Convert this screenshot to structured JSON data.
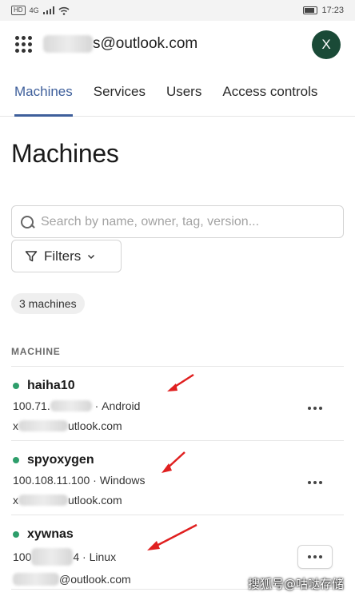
{
  "status_bar": {
    "left_chip": "HD",
    "signal": "4G",
    "time": "17:23"
  },
  "header": {
    "account_email_visible": "s@outlook.com",
    "avatar_letter": "X"
  },
  "tabs": [
    {
      "label": "Machines",
      "active": true
    },
    {
      "label": "Services",
      "active": false
    },
    {
      "label": "Users",
      "active": false
    },
    {
      "label": "Access controls",
      "active": false
    }
  ],
  "page_title": "Machines",
  "search": {
    "placeholder": "Search by name, owner, tag, version..."
  },
  "filters": {
    "label": "Filters"
  },
  "count_badge": "3 machines",
  "table": {
    "column_header": "MACHINE",
    "rows": [
      {
        "name": "haiha10",
        "ip_visible": "100.71.",
        "os": "Android",
        "owner_visible": "utlook.com",
        "status": "online"
      },
      {
        "name": "spyoxygen",
        "ip_visible": "100.108.11.100",
        "os": "Windows",
        "owner_visible": "utlook.com",
        "status": "online"
      },
      {
        "name": "xywnas",
        "ip_visible": "100",
        "ip_suffix": "4",
        "os": "Linux",
        "owner_visible": "@outlook.com",
        "status": "online"
      }
    ]
  },
  "watermark": "搜狐号@咕哒存储",
  "colors": {
    "accent": "#3e5f9b",
    "online": "#2e9e6b",
    "avatar_bg": "#1a4a37",
    "arrow": "#e02020"
  }
}
